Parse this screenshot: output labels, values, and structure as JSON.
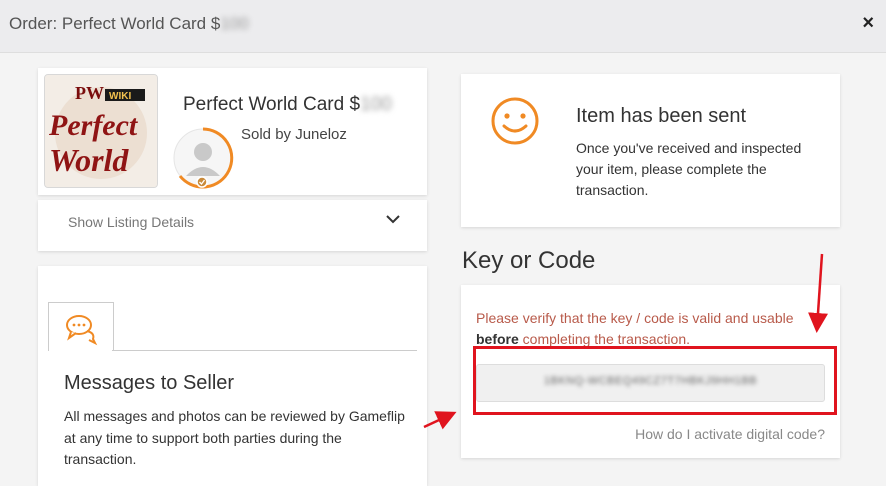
{
  "header": {
    "title_prefix": "Order: Perfect World Card $",
    "title_amount": "100",
    "close_glyph": "×"
  },
  "product": {
    "name_prefix": "Perfect World Card $",
    "name_amount": "100",
    "seller": "Sold by Juneloz",
    "thumbnail_text": [
      "PW",
      "Perfect",
      "World"
    ],
    "thumbnail_badge": "WIKI"
  },
  "listing": {
    "label": "Show Listing Details",
    "icon": "chevron-down-icon"
  },
  "messages": {
    "tab_icon": "chat-bubbles-icon",
    "heading": "Messages to Seller",
    "body": "All messages and photos can be reviewed by Gameflip at any time to support both parties during the transaction."
  },
  "status": {
    "icon": "smiley-icon",
    "heading": "Item has been sent",
    "body": "Once you've received and inspected your item, please complete the transaction."
  },
  "key_section": {
    "title": "Key or Code",
    "warning_part1": "Please verify that the key / code is valid and usable ",
    "warning_bold": "before",
    "warning_part2": " completing the transaction.",
    "code_value": "1BKNQ-WCBEQ49CZ7T7HBKJ9HH1BB",
    "help_link": "How do I activate digital code?"
  },
  "colors": {
    "accent_orange": "#f08a24",
    "warning_text": "#b85a4a",
    "annotation_red": "#e0141e"
  }
}
